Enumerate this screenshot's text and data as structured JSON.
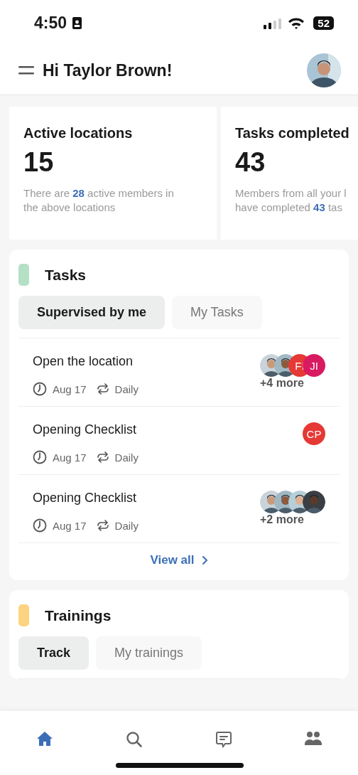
{
  "status_bar": {
    "time": "4:50",
    "battery": "52"
  },
  "header": {
    "greeting": "Hi Taylor Brown!"
  },
  "stats": [
    {
      "title": "Active locations",
      "value": "15",
      "description": "There are **28** active members in\nthe above locations"
    },
    {
      "title": "Tasks completed",
      "value": "43",
      "description": "Members from all your l\nhave completed **43** tas"
    }
  ],
  "tasks": {
    "title": "Tasks",
    "color": "#b5e0c6",
    "tabs": [
      {
        "label": "Supervised by me",
        "selected": true
      },
      {
        "label": "My Tasks",
        "selected": false
      }
    ],
    "items": [
      {
        "title": "Open the location",
        "date": "Aug 17",
        "repeat": "Daily",
        "assignees": [
          {
            "kind": "picture"
          },
          {
            "kind": "picture"
          },
          {
            "kind": "initials",
            "initials": "FI",
            "color": "#e53935"
          },
          {
            "kind": "initials",
            "initials": "JI",
            "color": "#d81b60"
          }
        ],
        "more": "+4 more"
      },
      {
        "title": "Opening Checklist",
        "date": "Aug 17",
        "repeat": "Daily",
        "assignees": [
          {
            "kind": "initials",
            "initials": "CP",
            "color": "#e53935"
          }
        ]
      },
      {
        "title": "Opening Checklist",
        "date": "Aug 17",
        "repeat": "Daily",
        "assignees": [
          {
            "kind": "picture"
          },
          {
            "kind": "picture"
          },
          {
            "kind": "picture"
          },
          {
            "kind": "picture"
          }
        ],
        "more": "+2 more"
      }
    ],
    "view_all": "View all"
  },
  "trainings": {
    "title": "Trainings",
    "color": "#fdd382",
    "tabs": [
      {
        "label": "Track",
        "selected": true
      },
      {
        "label": "My trainings",
        "selected": false
      }
    ]
  },
  "nav": [
    {
      "kind": "home",
      "selected": true
    },
    {
      "kind": "search",
      "selected": false
    },
    {
      "kind": "messages",
      "selected": false
    },
    {
      "kind": "people",
      "selected": false
    }
  ]
}
